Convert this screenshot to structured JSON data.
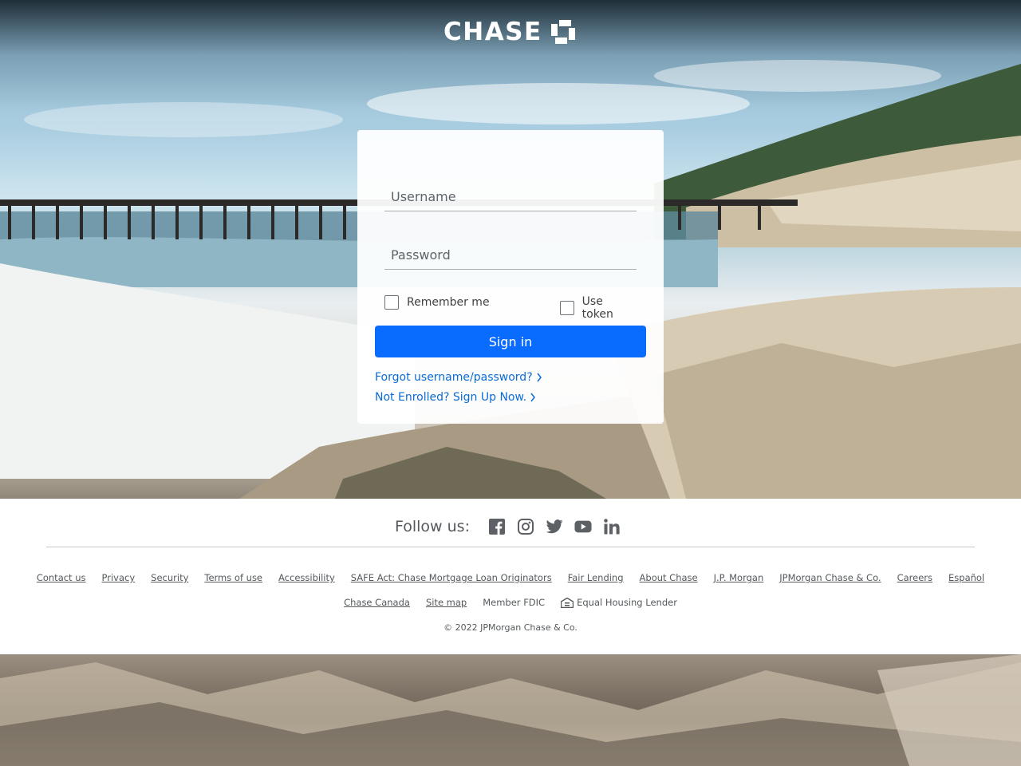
{
  "brand": {
    "name": "CHASE"
  },
  "login": {
    "username_placeholder": "Username",
    "password_placeholder": "Password",
    "remember_me_label": "Remember me",
    "use_token_label": "Use token",
    "sign_in_label": "Sign in",
    "forgot_link": "Forgot username/password?",
    "enroll_link": "Not Enrolled? Sign Up Now."
  },
  "footer": {
    "follow_label": "Follow us:",
    "social": [
      "facebook-icon",
      "instagram-icon",
      "twitter-icon",
      "youtube-icon",
      "linkedin-icon"
    ],
    "links_row1": [
      "Contact us",
      "Privacy",
      "Security",
      "Terms of use",
      "Accessibility",
      "SAFE Act: Chase Mortgage Loan Originators",
      "Fair Lending",
      "About Chase",
      "J.P. Morgan",
      "JPMorgan Chase & Co.",
      "Careers",
      "Español"
    ],
    "links_row2": {
      "chase_canada": "Chase Canada",
      "site_map": "Site map",
      "member_fdic": "Member FDIC",
      "equal_housing": "Equal Housing Lender"
    },
    "copyright": "© 2022 JPMorgan Chase & Co."
  },
  "colors": {
    "accent": "#0a6cff",
    "link": "#0b6bd6"
  }
}
